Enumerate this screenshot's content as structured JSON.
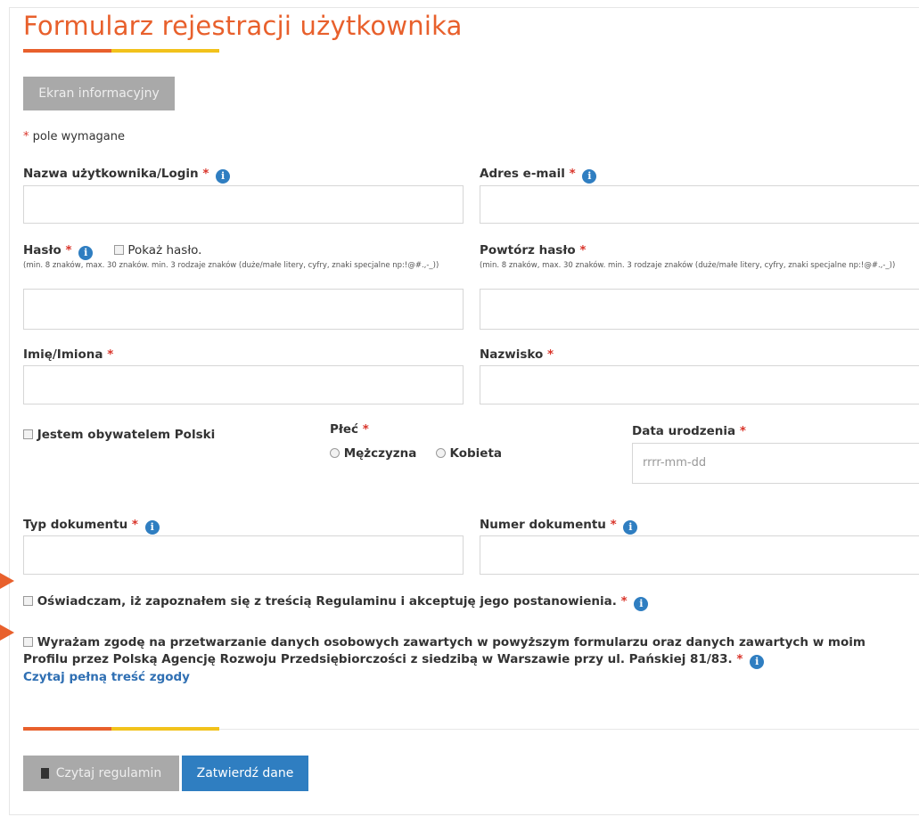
{
  "form": {
    "title": "Formularz rejestracji użytkownika",
    "info_button": "Ekran informacyjny",
    "required_mark": "*",
    "required_note": "pole wymagane",
    "info_glyph": "i"
  },
  "fields": {
    "login": {
      "label": "Nazwa użytkownika/Login",
      "value": ""
    },
    "email": {
      "label": "Adres e-mail",
      "value": ""
    },
    "password": {
      "label": "Hasło",
      "show_label": "Pokaż hasło.",
      "hint": "(min. 8 znaków, max. 30 znaków. min. 3 rodzaje znaków (duże/małe litery, cyfry, znaki specjalne np:!@#.,-_))",
      "value": ""
    },
    "password_repeat": {
      "label": "Powtórz hasło",
      "hint": "(min. 8 znaków, max. 30 znaków. min. 3 rodzaje znaków (duże/małe litery, cyfry, znaki specjalne np:!@#.,-_))",
      "value": ""
    },
    "first_name": {
      "label": "Imię/Imiona",
      "value": ""
    },
    "last_name": {
      "label": "Nazwisko",
      "value": ""
    },
    "citizen": {
      "label": "Jestem obywatelem Polski",
      "checked": false
    },
    "gender": {
      "label": "Płeć",
      "options": [
        "Mężczyzna",
        "Kobieta"
      ],
      "selected": ""
    },
    "birth_date": {
      "label": "Data urodzenia",
      "placeholder": "rrrr-mm-dd",
      "value": ""
    },
    "doc_type": {
      "label": "Typ dokumentu",
      "value": ""
    },
    "doc_number": {
      "label": "Numer dokumentu",
      "value": ""
    }
  },
  "consents": {
    "terms": {
      "text": "Oświadczam, iż zapoznałem się z treścią Regulaminu i akceptuję jego postanowienia.",
      "checked": false
    },
    "data": {
      "text_line1": "Wyrażam zgodę na przetwarzanie danych osobowych zawartych w powyższym formularzu oraz danych zawartych w moim",
      "text_line2": "Profilu przez Polską Agencję Rozwoju Przedsiębiorczości z siedzibą w Warszawie przy ul. Pańskiej 81/83.",
      "link": "Czytaj pełną treść zgody",
      "checked": false
    }
  },
  "footer": {
    "read_terms_button": "Czytaj regulamin",
    "submit_button": "Zatwierdź dane"
  },
  "colors": {
    "title": "#e8602c",
    "accent_orange": "#e8602c",
    "accent_yellow": "#f2c21b",
    "primary_button": "#2f7ec1",
    "secondary_button": "#a9a9a9",
    "required": "#d9342a",
    "link": "#2f6fb3"
  },
  "icons": {
    "info": "info-circle-icon",
    "checkbox": "checkbox-icon",
    "radio": "radio-icon",
    "book": "book-icon",
    "arrow": "pointer-arrow-icon"
  }
}
